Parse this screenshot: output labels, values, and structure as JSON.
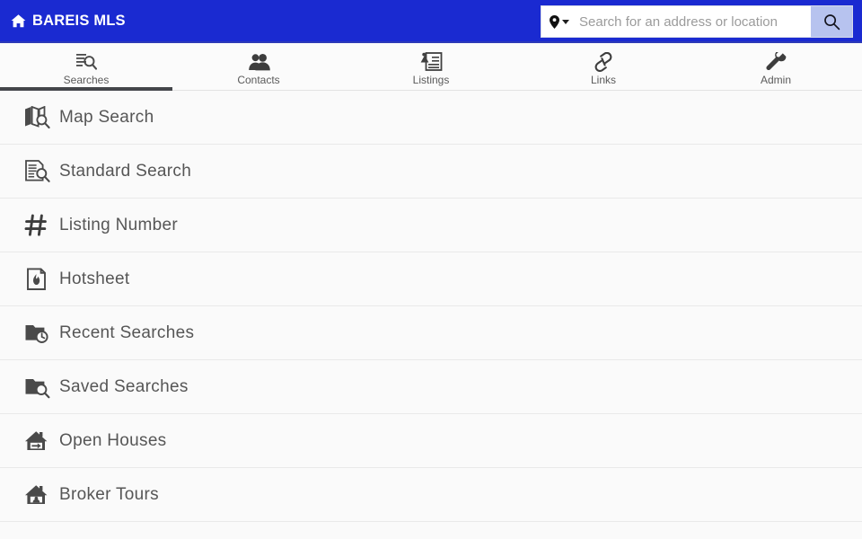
{
  "header": {
    "brand_icon": "home-icon",
    "brand_title": "BAREIS MLS",
    "brand_color": "#1a2ad1",
    "search": {
      "pin_icon": "map-pin-icon",
      "caret_icon": "chevron-down-icon",
      "placeholder": "Search for an address or location",
      "value": "",
      "button_icon": "search-icon",
      "button_color": "#b7c3ef"
    }
  },
  "tabs": {
    "active_index": 0,
    "active_underline_color": "#44464a",
    "items": [
      {
        "label": "Searches",
        "icon": "document-search-icon"
      },
      {
        "label": "Contacts",
        "icon": "users-icon"
      },
      {
        "label": "Listings",
        "icon": "listing-photo-icon"
      },
      {
        "label": "Links",
        "icon": "chain-link-icon"
      },
      {
        "label": "Admin",
        "icon": "wrench-icon"
      }
    ]
  },
  "menu": {
    "items": [
      {
        "label": "Map Search",
        "icon": "map-search-icon"
      },
      {
        "label": "Standard Search",
        "icon": "document-search-icon"
      },
      {
        "label": "Listing Number",
        "icon": "hash-icon"
      },
      {
        "label": "Hotsheet",
        "icon": "flame-document-icon"
      },
      {
        "label": "Recent Searches",
        "icon": "folder-clock-icon"
      },
      {
        "label": "Saved Searches",
        "icon": "folder-search-icon"
      },
      {
        "label": "Open Houses",
        "icon": "house-arrow-icon"
      },
      {
        "label": "Broker Tours",
        "icon": "house-person-icon"
      }
    ]
  }
}
